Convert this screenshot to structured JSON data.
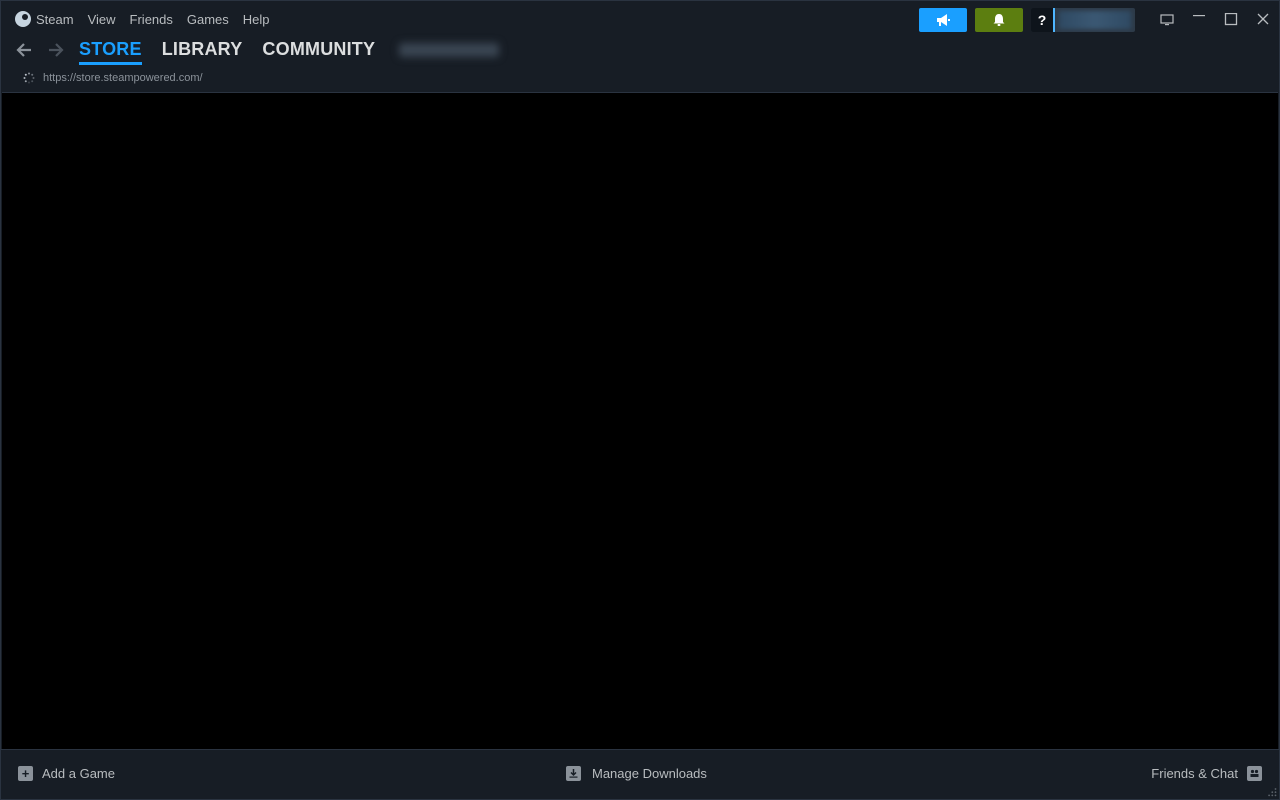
{
  "menu": {
    "app": "Steam",
    "items": [
      "View",
      "Friends",
      "Games",
      "Help"
    ]
  },
  "topbar": {
    "announce_icon": "megaphone-icon",
    "notif_icon": "bell-icon",
    "help_label": "?",
    "colors": {
      "announce": "#1a9fff",
      "notifications": "#5c7e10"
    }
  },
  "nav": {
    "tabs": [
      "STORE",
      "LIBRARY",
      "COMMUNITY"
    ],
    "active_tab": "STORE",
    "accent": "#1a9fff"
  },
  "url": {
    "text": "https://store.steampowered.com/"
  },
  "bottom": {
    "add_game": "Add a Game",
    "manage_downloads": "Manage Downloads",
    "friends_chat": "Friends & Chat"
  }
}
